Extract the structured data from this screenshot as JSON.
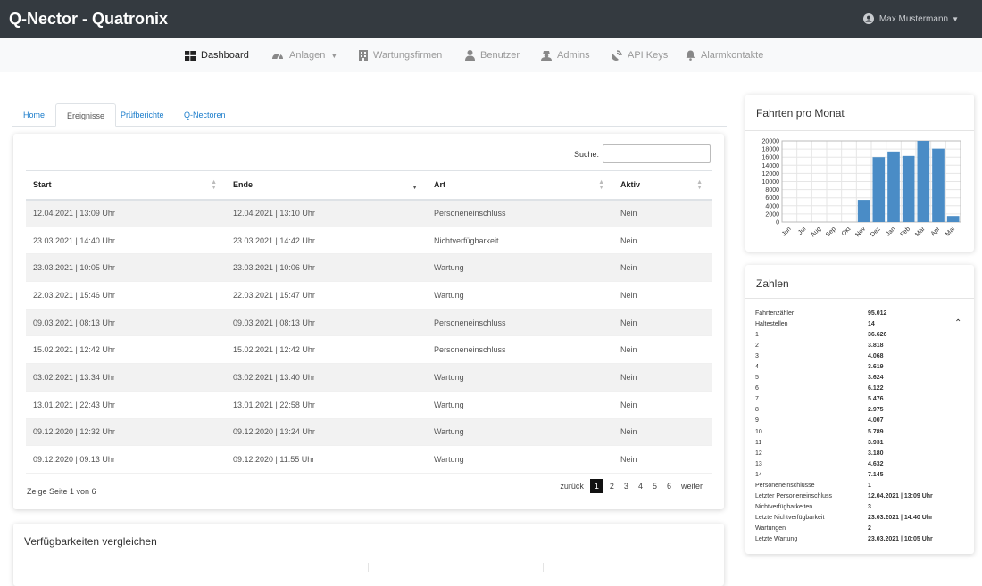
{
  "topbar": {
    "brand": "Q-Nector - Quatronix",
    "user_name": "Max Mustermann"
  },
  "nav": {
    "dashboard": "Dashboard",
    "anlagen": "Anlagen",
    "wartungsfirmen": "Wartungsfirmen",
    "benutzer": "Benutzer",
    "admins": "Admins",
    "api_keys": "API Keys",
    "alarmkontakte": "Alarmkontakte"
  },
  "tabs": {
    "home": "Home",
    "ereignisse": "Ereignisse",
    "pruefberichte": "Prüfberichte",
    "qnectoren": "Q-Nectoren"
  },
  "events": {
    "search_label": "Suche:",
    "search_value": "",
    "columns": {
      "start": "Start",
      "ende": "Ende",
      "art": "Art",
      "aktiv": "Aktiv"
    },
    "rows": [
      {
        "start": "12.04.2021 | 13:09 Uhr",
        "ende": "12.04.2021 | 13:10 Uhr",
        "art": "Personeneinschluss",
        "aktiv": "Nein"
      },
      {
        "start": "23.03.2021 | 14:40 Uhr",
        "ende": "23.03.2021 | 14:42 Uhr",
        "art": "Nichtverfügbarkeit",
        "aktiv": "Nein"
      },
      {
        "start": "23.03.2021 | 10:05 Uhr",
        "ende": "23.03.2021 | 10:06 Uhr",
        "art": "Wartung",
        "aktiv": "Nein"
      },
      {
        "start": "22.03.2021 | 15:46 Uhr",
        "ende": "22.03.2021 | 15:47 Uhr",
        "art": "Wartung",
        "aktiv": "Nein"
      },
      {
        "start": "09.03.2021 | 08:13 Uhr",
        "ende": "09.03.2021 | 08:13 Uhr",
        "art": "Personeneinschluss",
        "aktiv": "Nein"
      },
      {
        "start": "15.02.2021 | 12:42 Uhr",
        "ende": "15.02.2021 | 12:42 Uhr",
        "art": "Personeneinschluss",
        "aktiv": "Nein"
      },
      {
        "start": "03.02.2021 | 13:34 Uhr",
        "ende": "03.02.2021 | 13:40 Uhr",
        "art": "Wartung",
        "aktiv": "Nein"
      },
      {
        "start": "13.01.2021 | 22:43 Uhr",
        "ende": "13.01.2021 | 22:58 Uhr",
        "art": "Wartung",
        "aktiv": "Nein"
      },
      {
        "start": "09.12.2020 | 12:32 Uhr",
        "ende": "09.12.2020 | 13:24 Uhr",
        "art": "Wartung",
        "aktiv": "Nein"
      },
      {
        "start": "09.12.2020 | 09:13 Uhr",
        "ende": "09.12.2020 | 11:55 Uhr",
        "art": "Wartung",
        "aktiv": "Nein"
      }
    ],
    "page_info": "Zeige Seite 1 von 6",
    "pager": {
      "prev": "zurück",
      "pages": [
        "1",
        "2",
        "3",
        "4",
        "5",
        "6"
      ],
      "next": "weiter"
    }
  },
  "verfuegbarkeit": {
    "title": "Verfügbarkeiten vergleichen"
  },
  "fahrten": {
    "title": "Fahrten pro Monat"
  },
  "chart_data": {
    "type": "bar",
    "title": "Fahrten pro Monat",
    "categories": [
      "Jun",
      "Jul",
      "Aug",
      "Sep",
      "Okt",
      "Nov",
      "Dez",
      "Jan",
      "Feb",
      "Mär",
      "Apr",
      "Mai"
    ],
    "values": [
      0,
      0,
      0,
      0,
      0,
      5476,
      16000,
      17400,
      16300,
      20000,
      18100,
      1500
    ],
    "ylim": [
      0,
      20000
    ],
    "yticks": [
      0,
      2000,
      4000,
      6000,
      8000,
      10000,
      12000,
      14000,
      16000,
      18000,
      20000
    ],
    "grid": true,
    "bar_color": "#4a8cc6"
  },
  "zahlen": {
    "title": "Zahlen",
    "rows": [
      {
        "k": "Fahrtenzähler",
        "v": "95.012"
      },
      {
        "k": "Haltestellen",
        "v": "14"
      },
      {
        "k": "1",
        "v": "36.626"
      },
      {
        "k": "2",
        "v": "3.818"
      },
      {
        "k": "3",
        "v": "4.068"
      },
      {
        "k": "4",
        "v": "3.619"
      },
      {
        "k": "5",
        "v": "3.624"
      },
      {
        "k": "6",
        "v": "6.122"
      },
      {
        "k": "7",
        "v": "5.476"
      },
      {
        "k": "8",
        "v": "2.975"
      },
      {
        "k": "9",
        "v": "4.007"
      },
      {
        "k": "10",
        "v": "5.789"
      },
      {
        "k": "11",
        "v": "3.931"
      },
      {
        "k": "12",
        "v": "3.180"
      },
      {
        "k": "13",
        "v": "4.632"
      },
      {
        "k": "14",
        "v": "7.145"
      },
      {
        "k": "Personeneinschlüsse",
        "v": "1"
      },
      {
        "k": "Letzter Personeneinschluss",
        "v": "12.04.2021 | 13:09 Uhr"
      },
      {
        "k": "Nichtverfügbarkeiten",
        "v": "3"
      },
      {
        "k": "Letzte Nichtverfügbarkeit",
        "v": "23.03.2021 | 14:40 Uhr"
      },
      {
        "k": "Wartungen",
        "v": "2"
      },
      {
        "k": "Letzte Wartung",
        "v": "23.03.2021 | 10:05 Uhr"
      }
    ]
  }
}
